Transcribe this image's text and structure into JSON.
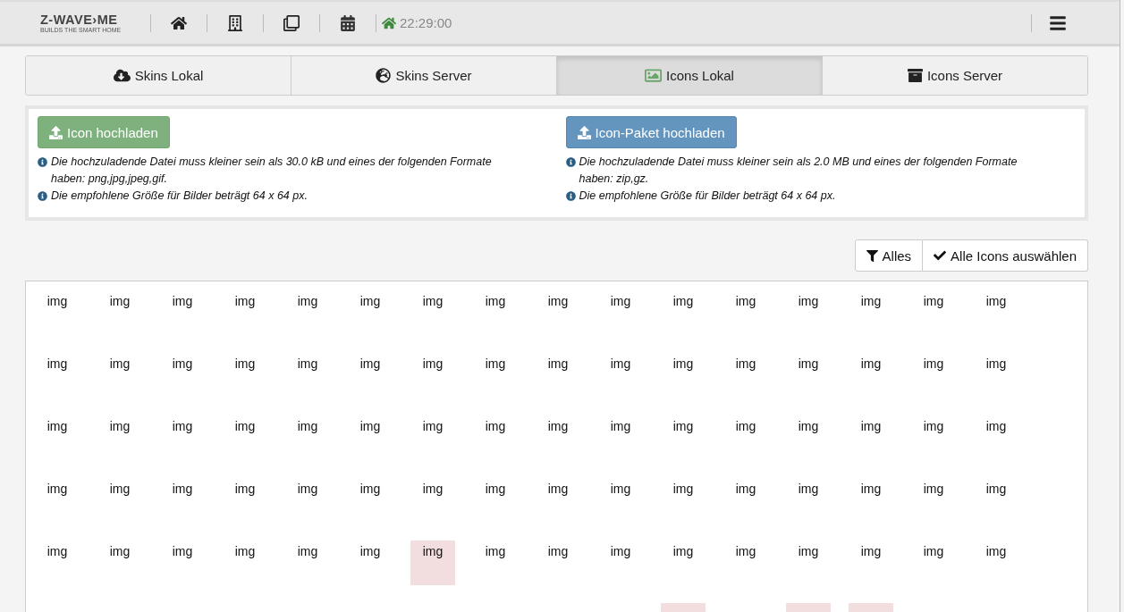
{
  "navbar": {
    "logo": {
      "name": "Z-WAVE›ME",
      "tagline": "BUILDS THE SMART HOME"
    },
    "time": "22:29:00"
  },
  "tabs": [
    {
      "kind": "skins-local",
      "label": "Skins Lokal",
      "selected": false
    },
    {
      "kind": "skins-server",
      "label": "Skins Server",
      "selected": false
    },
    {
      "kind": "icons-local",
      "label": "Icons Lokal",
      "selected": true
    },
    {
      "kind": "icons-server",
      "label": "Icons Server",
      "selected": false
    }
  ],
  "upload": [
    {
      "button": "Icon hochladen",
      "kind": "success",
      "notes": [
        "Die hochzuladende Datei muss kleiner sein als 30.0 kB und eines der folgenden Formate haben: png,jpg,jpeg,gif.",
        "Die empfohlene Größe für Bilder beträgt 64 x 64 px."
      ]
    },
    {
      "button": "Icon-Paket hochladen",
      "kind": "primary",
      "notes": [
        "Die hochzuladende Datei muss kleiner sein als 2.0 MB und eines der folgenden Formate haben: zip,gz.",
        "Die empfohlene Größe für Bilder beträgt 64 x 64 px."
      ]
    }
  ],
  "toolbar": {
    "filter": "Alles",
    "select_all": "Alle Icons auswählen"
  },
  "icons": [
    [
      {
        "label": "img",
        "highlighted": false
      },
      {
        "label": "img",
        "highlighted": false
      },
      {
        "label": "img",
        "highlighted": false
      },
      {
        "label": "img",
        "highlighted": false
      },
      {
        "label": "img",
        "highlighted": false
      },
      {
        "label": "img",
        "highlighted": false
      },
      {
        "label": "img",
        "highlighted": false
      },
      {
        "label": "img",
        "highlighted": false
      },
      {
        "label": "img",
        "highlighted": false
      },
      {
        "label": "img",
        "highlighted": false
      },
      {
        "label": "img",
        "highlighted": false
      },
      {
        "label": "img",
        "highlighted": false
      },
      {
        "label": "img",
        "highlighted": false
      },
      {
        "label": "img",
        "highlighted": false
      },
      {
        "label": "img",
        "highlighted": false
      },
      {
        "label": "img",
        "highlighted": false
      }
    ],
    [
      {
        "label": "img",
        "highlighted": false
      },
      {
        "label": "img",
        "highlighted": false
      },
      {
        "label": "img",
        "highlighted": false
      },
      {
        "label": "img",
        "highlighted": false
      },
      {
        "label": "img",
        "highlighted": false
      },
      {
        "label": "img",
        "highlighted": false
      },
      {
        "label": "img",
        "highlighted": false
      },
      {
        "label": "img",
        "highlighted": false
      },
      {
        "label": "img",
        "highlighted": false
      },
      {
        "label": "img",
        "highlighted": false
      },
      {
        "label": "img",
        "highlighted": false
      },
      {
        "label": "img",
        "highlighted": false
      },
      {
        "label": "img",
        "highlighted": false
      },
      {
        "label": "img",
        "highlighted": false
      },
      {
        "label": "img",
        "highlighted": false
      },
      {
        "label": "img",
        "highlighted": false
      }
    ],
    [
      {
        "label": "img",
        "highlighted": false
      },
      {
        "label": "img",
        "highlighted": false
      },
      {
        "label": "img",
        "highlighted": false
      },
      {
        "label": "img",
        "highlighted": false
      },
      {
        "label": "img",
        "highlighted": false
      },
      {
        "label": "img",
        "highlighted": false
      },
      {
        "label": "img",
        "highlighted": false
      },
      {
        "label": "img",
        "highlighted": false
      },
      {
        "label": "img",
        "highlighted": false
      },
      {
        "label": "img",
        "highlighted": false
      },
      {
        "label": "img",
        "highlighted": false
      },
      {
        "label": "img",
        "highlighted": false
      },
      {
        "label": "img",
        "highlighted": false
      },
      {
        "label": "img",
        "highlighted": false
      },
      {
        "label": "img",
        "highlighted": false
      },
      {
        "label": "img",
        "highlighted": false
      }
    ],
    [
      {
        "label": "img",
        "highlighted": false
      },
      {
        "label": "img",
        "highlighted": false
      },
      {
        "label": "img",
        "highlighted": false
      },
      {
        "label": "img",
        "highlighted": false
      },
      {
        "label": "img",
        "highlighted": false
      },
      {
        "label": "img",
        "highlighted": false
      },
      {
        "label": "img",
        "highlighted": false
      },
      {
        "label": "img",
        "highlighted": false
      },
      {
        "label": "img",
        "highlighted": false
      },
      {
        "label": "img",
        "highlighted": false
      },
      {
        "label": "img",
        "highlighted": false
      },
      {
        "label": "img",
        "highlighted": false
      },
      {
        "label": "img",
        "highlighted": false
      },
      {
        "label": "img",
        "highlighted": false
      },
      {
        "label": "img",
        "highlighted": false
      },
      {
        "label": "img",
        "highlighted": false
      }
    ],
    [
      {
        "label": "img",
        "highlighted": false
      },
      {
        "label": "img",
        "highlighted": false
      },
      {
        "label": "img",
        "highlighted": false
      },
      {
        "label": "img",
        "highlighted": false
      },
      {
        "label": "img",
        "highlighted": false
      },
      {
        "label": "img",
        "highlighted": false
      },
      {
        "label": "img",
        "highlighted": true
      },
      {
        "label": "img",
        "highlighted": false
      },
      {
        "label": "img",
        "highlighted": false
      },
      {
        "label": "img",
        "highlighted": false
      },
      {
        "label": "img",
        "highlighted": false
      },
      {
        "label": "img",
        "highlighted": false
      },
      {
        "label": "img",
        "highlighted": false
      },
      {
        "label": "img",
        "highlighted": false
      },
      {
        "label": "img",
        "highlighted": false
      },
      {
        "label": "img",
        "highlighted": false
      }
    ],
    [
      {
        "highlighted": false
      },
      {
        "highlighted": false
      },
      {
        "highlighted": false
      },
      {
        "highlighted": false
      },
      {
        "highlighted": false
      },
      {
        "highlighted": false
      },
      {
        "highlighted": false
      },
      {
        "highlighted": false
      },
      {
        "highlighted": false
      },
      {
        "highlighted": false
      },
      {
        "highlighted": true
      },
      {
        "highlighted": false
      },
      {
        "highlighted": true
      },
      {
        "highlighted": true
      },
      {
        "highlighted": false
      },
      {
        "highlighted": false
      }
    ]
  ]
}
